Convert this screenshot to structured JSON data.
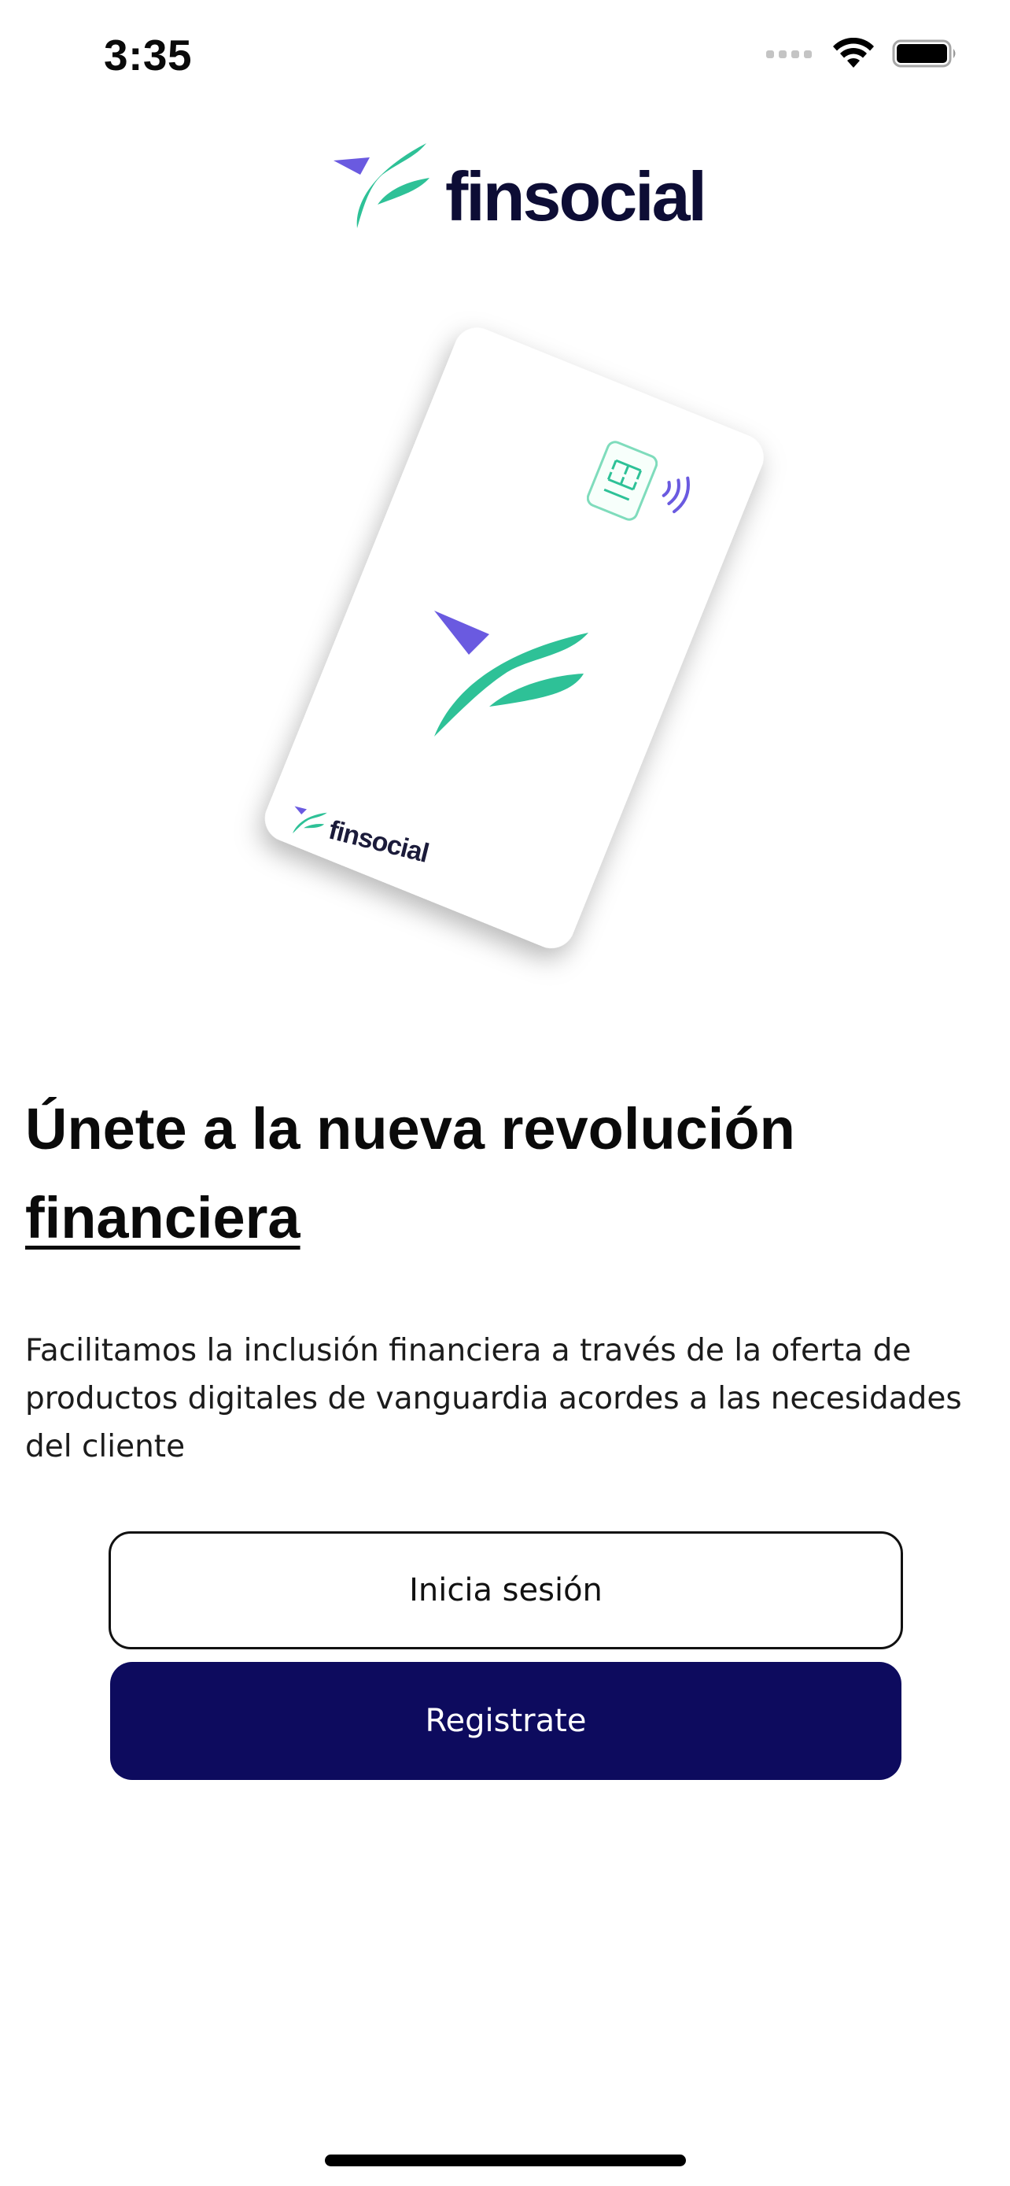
{
  "status_bar": {
    "time": "3:35"
  },
  "brand": {
    "wordmark": "finsocial",
    "card_wordmark": "finsocial"
  },
  "content": {
    "headline_part1": "Únete a la nueva revolución ",
    "headline_part2": "financiera",
    "description": "Facilitamos la inclusión financiera a través de la oferta de productos digitales de vanguardia acordes a las necesidades del cliente"
  },
  "actions": {
    "login_label": "Inicia sesión",
    "register_label": "Registrate"
  },
  "colors": {
    "brand_navy": "#0d0b5e",
    "brand_green": "#2ec197",
    "brand_purple": "#6a5ae0"
  },
  "icons": {
    "signal": "cellular-signal-icon",
    "wifi": "wifi-icon",
    "battery": "battery-icon",
    "contactless": "contactless-icon",
    "chip": "card-chip-icon"
  }
}
